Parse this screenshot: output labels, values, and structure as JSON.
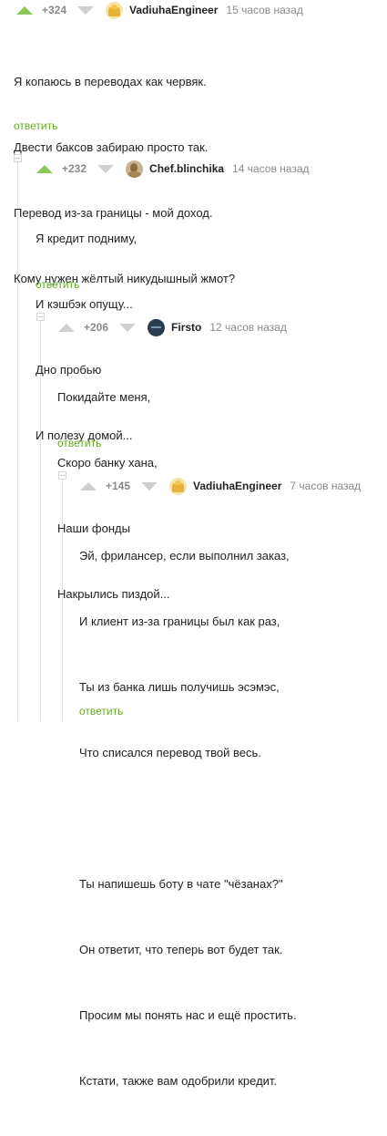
{
  "comments": [
    {
      "rating": "+324",
      "username": "VadiuhaEngineer",
      "time": "15 часов назад",
      "lines": [
        "Я копаюсь в переводах как червяк.",
        "Двести баксов забираю просто так.",
        "Перевод из-за границы - мой доход.",
        "Кому нужен жёлтый никудышный жмот?"
      ],
      "reply": "ответить"
    },
    {
      "rating": "+232",
      "username": "Chef.blinchika",
      "time": "14 часов назад",
      "lines": [
        "Я кредит подниму,",
        "И кэшбэк опущу...",
        "Дно пробью",
        "И полезу домой..."
      ],
      "reply": "ответить"
    },
    {
      "rating": "+206",
      "username": "Firsto",
      "time": "12 часов назад",
      "lines": [
        "Покидайте меня,",
        "Скоро банку хана,",
        "Наши фонды",
        "Накрылись пиздой..."
      ],
      "reply": "ответить"
    },
    {
      "rating": "+145",
      "username": "VadiuhaEngineer",
      "time": "7 часов назад",
      "lines": [
        "Эй, фрилансер, если выполнил заказ,",
        "И клиент из-за границы был как раз,",
        "Ты из банка лишь получишь эсэмэс,",
        "Что списался перевод твой весь.",
        "",
        "Ты напишешь боту в чате \"чёзанах?\"",
        "Он ответит, что теперь вот будет так.",
        "Просим мы понять нас и ещё простить.",
        "Кстати, также вам одобрили кредит."
      ],
      "reply": "ответить"
    }
  ],
  "colors": {
    "upvote_active": "#8ac858",
    "vote_inactive": "#cfcfcf",
    "reply_link": "#6aa82d"
  }
}
